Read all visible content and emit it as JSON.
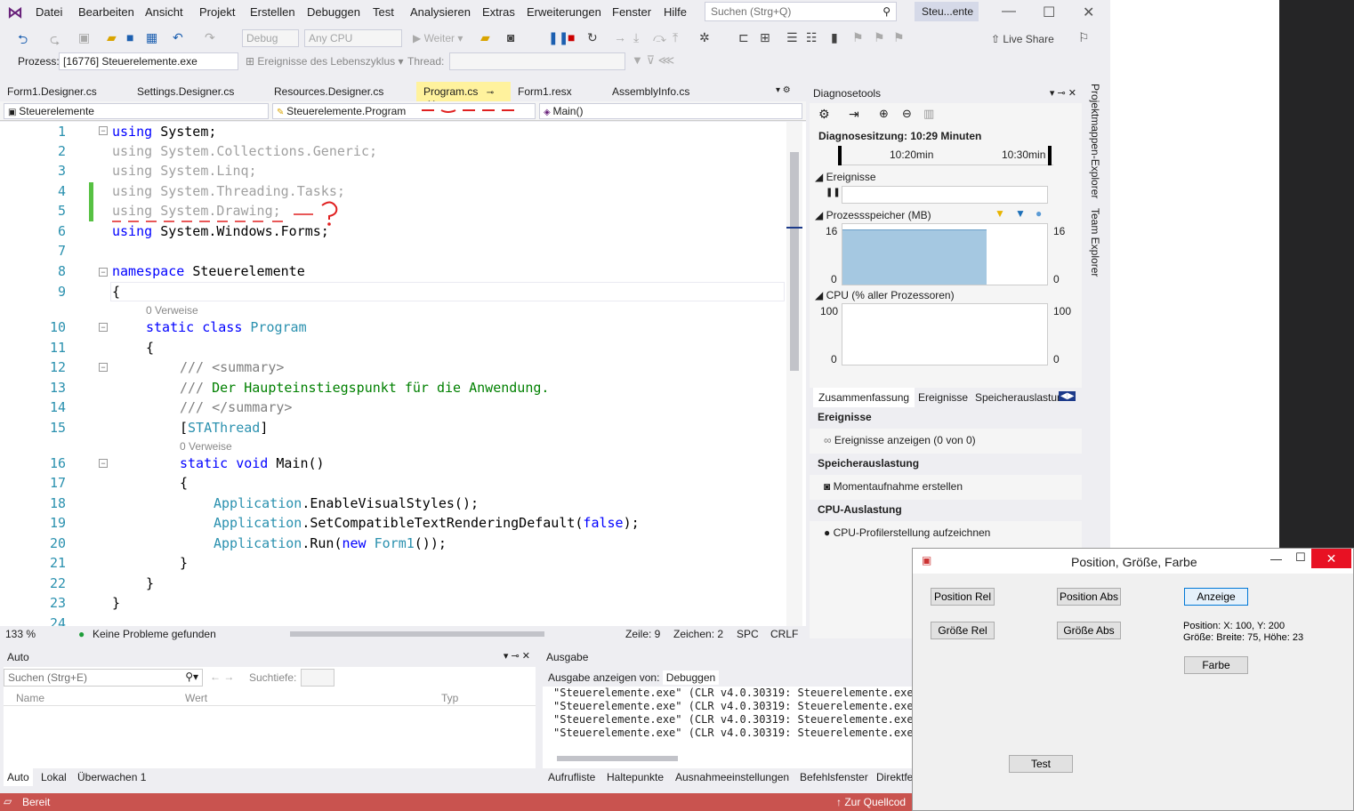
{
  "menu": [
    "Datei",
    "Bearbeiten",
    "Ansicht",
    "Projekt",
    "Erstellen",
    "Debuggen",
    "Test",
    "Analysieren",
    "Extras",
    "Erweiterungen",
    "Fenster",
    "Hilfe"
  ],
  "search": {
    "placeholder": "Suchen (Strg+Q)"
  },
  "solution_badge": "Steu...ente",
  "toolbar": {
    "config": "Debug",
    "platform": "Any CPU",
    "continue": "Weiter",
    "live_share": "Live Share"
  },
  "toolbar2": {
    "process_label": "Prozess:",
    "process_value": "[16776] Steuerelemente.exe",
    "lifecycle": "Ereignisse des Lebenszyklus",
    "thread_label": "Thread:"
  },
  "tabs": [
    "Form1.Designer.cs",
    "Settings.Designer.cs",
    "Resources.Designer.cs",
    "Program.cs",
    "Form1.resx",
    "AssemblyInfo.cs"
  ],
  "active_tab": "Program.cs",
  "nav": {
    "project": "Steuerelemente",
    "class": "Steuerelemente.Program",
    "member": "Main()"
  },
  "references": "0 Verweise",
  "code": {
    "l1": "System;",
    "l2": "System.Collections.Generic;",
    "l3": "System.Linq;",
    "l4": "System.Threading.Tasks;",
    "l5": "System.Drawing;",
    "l6": "System.Windows.Forms;",
    "l8_ns": "Steuerelemente",
    "l9": "{",
    "l10_cls": "Program",
    "l11": "{",
    "l12": "/// <summary>",
    "l13a": "///",
    "l13b": " Der Haupteinstiegspunkt für die Anwendung.",
    "l14": "/// </summary>",
    "l15": "STAThread",
    "l16": "Main()",
    "l17": "{",
    "l18a": "Application",
    "l18b": ".EnableVisualStyles();",
    "l19a": "Application",
    "l19b": ".SetCompatibleTextRenderingDefault(",
    "l19c": "false",
    "l19d": ");",
    "l20a": "Application",
    "l20b": ".Run(",
    "l20c": "new",
    "l20d": "Form1",
    "l20e": "());",
    "l21": "}",
    "l22": "}",
    "l23": "}",
    "kw_using": "using",
    "kw_namespace": "namespace",
    "kw_static": "static",
    "kw_class": "class",
    "kw_void": "void"
  },
  "line_numbers": [
    "1",
    "2",
    "3",
    "4",
    "5",
    "6",
    "7",
    "8",
    "9",
    "10",
    "11",
    "12",
    "13",
    "14",
    "15",
    "16",
    "17",
    "18",
    "19",
    "20",
    "21",
    "22",
    "23",
    "24"
  ],
  "editor_status": {
    "zoom": "133 %",
    "problems": "Keine Probleme gefunden",
    "line": "Zeile: 9",
    "char": "Zeichen: 2",
    "spc": "SPC",
    "crlf": "CRLF"
  },
  "diag": {
    "title": "Diagnosetools",
    "session": "Diagnosesitzung: 10:29 Minuten",
    "t1": "10:20min",
    "t2": "10:30min",
    "events": "Ereignisse",
    "memory": "Prozessspeicher (MB)",
    "mem_max": "16",
    "mem_min": "0",
    "cpu": "CPU (% aller Prozessoren)",
    "cpu_max": "100",
    "cpu_min": "0",
    "tabs": [
      "Zusammenfassung",
      "Ereignisse",
      "Speicherauslastur"
    ],
    "sec_events": "Ereignisse",
    "show_events": "Ereignisse anzeigen (0 von 0)",
    "sec_mem": "Speicherauslastung",
    "snapshot": "Momentaufnahme erstellen",
    "sec_cpu": "CPU-Auslastung",
    "cpu_profile": "CPU-Profilerstellung aufzeichnen"
  },
  "sidebar": {
    "solution_explorer": "Projektmappen-Explorer",
    "team_explorer": "Team Explorer"
  },
  "auto": {
    "title": "Auto",
    "search": "Suchen (Strg+E)",
    "depth": "Suchtiefe:",
    "cols": [
      "Name",
      "Wert",
      "Typ"
    ],
    "tabs": [
      "Auto",
      "Lokal",
      "Überwachen 1"
    ]
  },
  "output": {
    "title": "Ausgabe",
    "show_from": "Ausgabe anzeigen von:",
    "source": "Debuggen",
    "lines": [
      "\"Steuerelemente.exe\" (CLR v4.0.30319: Steuerelemente.exe):",
      "\"Steuerelemente.exe\" (CLR v4.0.30319: Steuerelemente.exe):",
      "\"Steuerelemente.exe\" (CLR v4.0.30319: Steuerelemente.exe):",
      "\"Steuerelemente.exe\" (CLR v4.0.30319: Steuerelemente.exe):"
    ],
    "tabs": [
      "Aufrufliste",
      "Haltepunkte",
      "Ausnahmeeinstellungen",
      "Befehlsfenster",
      "Direktfe"
    ]
  },
  "status": {
    "ready": "Bereit",
    "source": "Zur Quellcod"
  },
  "form": {
    "title": "Position, Größe, Farbe",
    "pos_rel": "Position Rel",
    "pos_abs": "Position Abs",
    "anzeige": "Anzeige",
    "size_rel": "Größe Rel",
    "size_abs": "Größe Abs",
    "info1": "Position: X: 100, Y: 200",
    "info2": "Größe: Breite: 75, Höhe: 23",
    "farbe": "Farbe",
    "test": "Test"
  },
  "colors": {
    "accent": "#68217a",
    "status": "#c9534f",
    "active_tab": "#fff29d"
  }
}
